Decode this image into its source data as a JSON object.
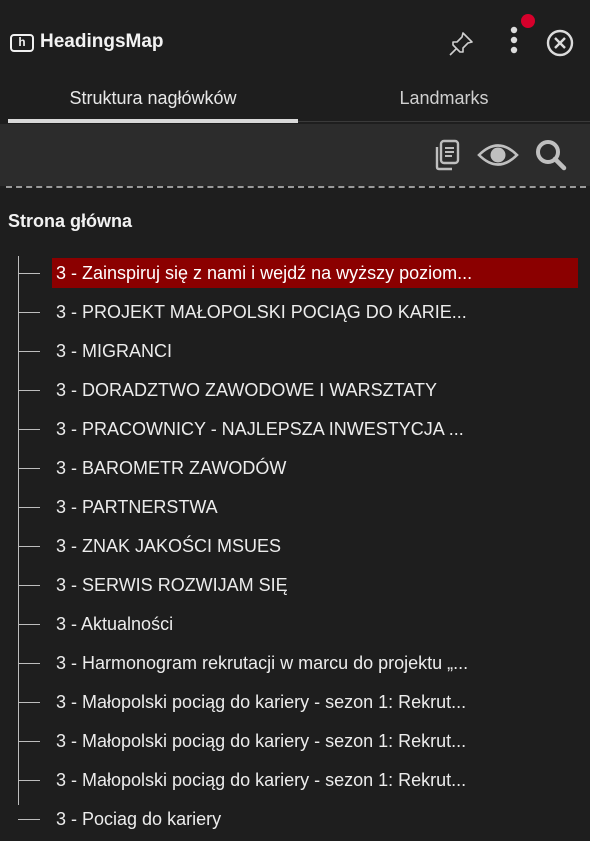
{
  "app": {
    "logo_text": "h",
    "title": "HeadingsMap"
  },
  "header_icons": {
    "pin": "pin-icon",
    "menu": "kebab-menu-icon",
    "notification_color": "#d6002b",
    "close": "close-circle-icon"
  },
  "tabs": [
    {
      "label": "Struktura nagłówków",
      "active": true
    },
    {
      "label": "Landmarks",
      "active": false
    }
  ],
  "toolbar": {
    "icons": [
      "copy-icon",
      "eye-icon",
      "search-icon"
    ]
  },
  "tree": {
    "root": "Strona główna",
    "items": [
      {
        "label": "3 - Zainspiruj się z nami i wejdź na wyższy poziom...",
        "active": true
      },
      {
        "label": "3 - PROJEKT MAŁOPOLSKI POCIĄG DO KARIE...",
        "active": false
      },
      {
        "label": "3 - MIGRANCI",
        "active": false
      },
      {
        "label": "3 - DORADZTWO ZAWODOWE I WARSZTATY",
        "active": false
      },
      {
        "label": "3 - PRACOWNICY - NAJLEPSZA INWESTYCJA ...",
        "active": false
      },
      {
        "label": "3 - BAROMETR ZAWODÓW",
        "active": false
      },
      {
        "label": "3 - PARTNERSTWA",
        "active": false
      },
      {
        "label": "3 - ZNAK JAKOŚCI MSUES",
        "active": false
      },
      {
        "label": "3 - SERWIS ROZWIJAM SIĘ",
        "active": false
      },
      {
        "label": "3 - Aktualności",
        "active": false
      },
      {
        "label": "3 - Harmonogram rekrutacji w marcu do projektu „...",
        "active": false
      },
      {
        "label": "3 - Małopolski pociąg do kariery - sezon 1: Rekrut...",
        "active": false
      },
      {
        "label": "3 - Małopolski pociąg do kariery - sezon 1: Rekrut...",
        "active": false
      },
      {
        "label": "3 - Małopolski pociąg do kariery - sezon 1: Rekrut...",
        "active": false
      },
      {
        "label": "3 - Pociag do kariery",
        "active": false
      }
    ]
  },
  "colors": {
    "background": "#1e1e1e",
    "toolbar": "#2c2c2c",
    "active_item": "#8b0000",
    "text": "#ececec"
  }
}
